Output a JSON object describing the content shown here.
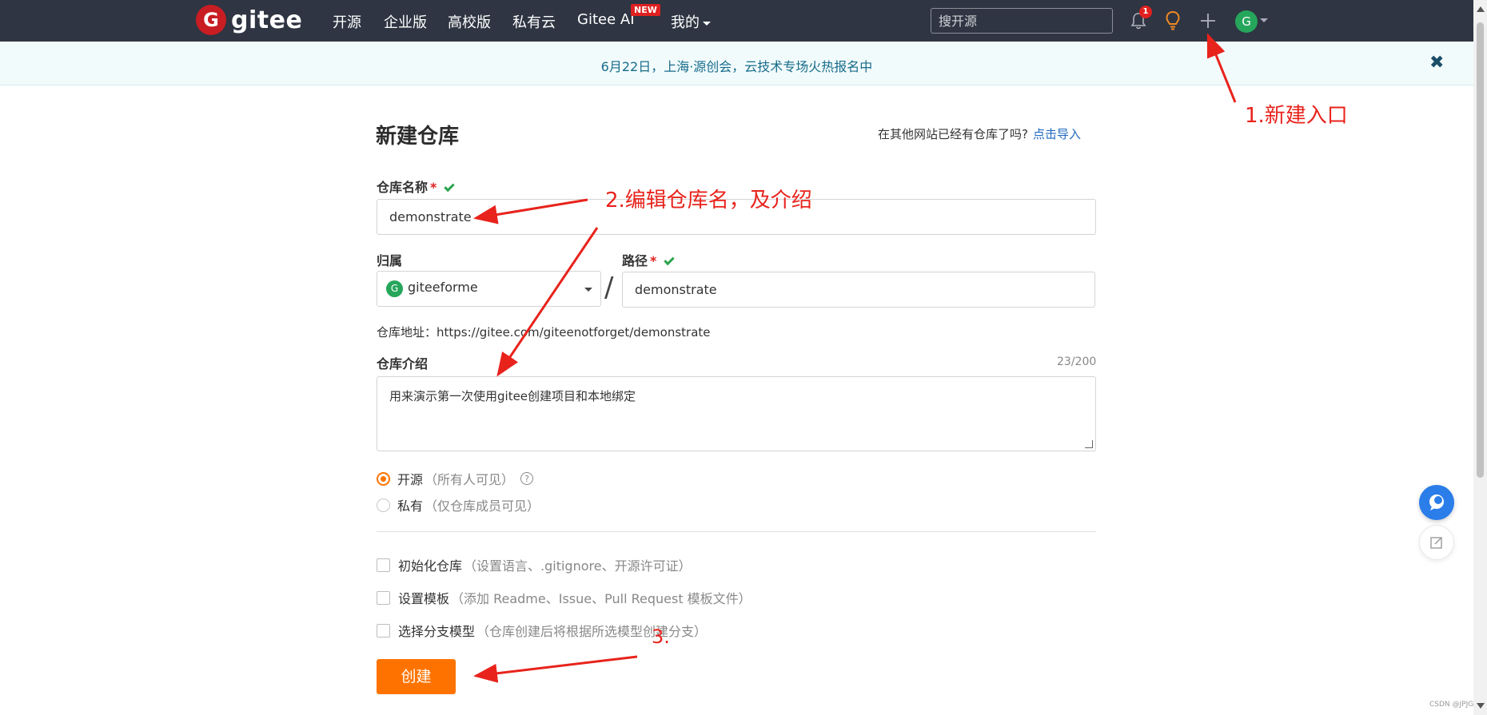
{
  "nav": {
    "logo_text": "gitee",
    "logo_mark": "G",
    "items": [
      "开源",
      "企业版",
      "高校版",
      "私有云",
      "Gitee AI",
      "我的"
    ],
    "new_badge": "NEW",
    "search_placeholder": "搜开源",
    "notification_count": "1",
    "avatar_initial": "G",
    "icons": [
      "bell-icon",
      "lightbulb-icon",
      "plus-icon"
    ]
  },
  "banner": {
    "text": "6月22日，上海·源创会，云技术专场火热报名中",
    "close": "✖"
  },
  "form": {
    "title": "新建仓库",
    "import_hint": "在其他网站已经有仓库了吗?",
    "import_link": "点击导入",
    "name_label": "仓库名称",
    "name_value": "demonstrate",
    "owner_label": "归属",
    "owner_avatar": "G",
    "owner_value": "giteeforme",
    "path_label": "路径",
    "path_value": "demonstrate",
    "required_mark": "*",
    "slash": "/",
    "url_label": "仓库地址：",
    "url_value": "https://gitee.com/giteenotforget/demonstrate",
    "desc_label": "仓库介绍",
    "desc_count": "23/200",
    "desc_value": "用来演示第一次使用gitee创建项目和本地绑定",
    "visibility": [
      {
        "label": "开源",
        "hint": "（所有人可见）",
        "selected": true
      },
      {
        "label": "私有",
        "hint": "（仅仓库成员可见）",
        "selected": false
      }
    ],
    "help": "?",
    "options": [
      {
        "label": "初始化仓库",
        "hint": "（设置语言、.gitignore、开源许可证）"
      },
      {
        "label": "设置模板",
        "hint": "（添加 Readme、Issue、Pull Request 模板文件）"
      },
      {
        "label": "选择分支模型",
        "hint": "（仓库创建后将根据所选模型创建分支）"
      }
    ],
    "submit": "创建"
  },
  "annotations": {
    "step1": "1.新建入口",
    "step2": "2.编辑仓库名，及介绍",
    "step3": "3."
  },
  "watermark": "CSDN @JPJG",
  "colors": {
    "nav_bg": "#2f3542",
    "brand_red": "#c71d23",
    "accent_orange": "#fe7300",
    "link_blue": "#1f69c0",
    "annotation_red": "#e8231c",
    "success_green": "#2da44e"
  }
}
